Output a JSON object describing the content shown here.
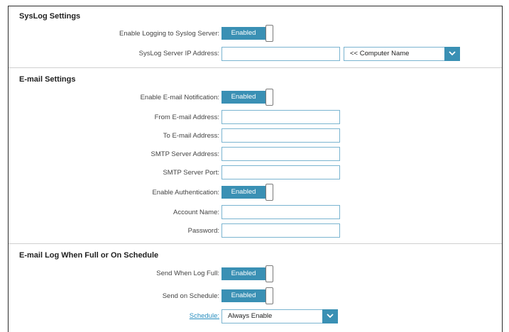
{
  "syslog": {
    "title": "SysLog Settings",
    "enable_label": "Enable Logging to Syslog Server:",
    "enable_state": "Enabled",
    "ip_label": "SysLog Server IP Address:",
    "ip_value": "",
    "computer_select": "<< Computer Name"
  },
  "email": {
    "title": "E-mail Settings",
    "notify_label": "Enable E-mail Notification:",
    "notify_state": "Enabled",
    "from_label": "From E-mail Address:",
    "from_value": "",
    "to_label": "To E-mail Address:",
    "to_value": "",
    "smtp_address_label": "SMTP Server Address:",
    "smtp_address_value": "",
    "smtp_port_label": "SMTP Server Port:",
    "smtp_port_value": "",
    "auth_label": "Enable Authentication:",
    "auth_state": "Enabled",
    "account_label": "Account Name:",
    "account_value": "",
    "password_label": "Password:",
    "password_value": ""
  },
  "schedule": {
    "title": "E-mail Log When Full or On Schedule",
    "full_label": "Send When Log Full:",
    "full_state": "Enabled",
    "on_schedule_label": "Send on Schedule:",
    "on_schedule_state": "Enabled",
    "schedule_link": "Schedule:",
    "schedule_select": "Always Enable"
  },
  "colors": {
    "accent": "#3a90b4",
    "input_border": "#7ab4d0",
    "link": "#2a8fc0"
  },
  "icons": {
    "dropdown": "chevron-down-icon"
  }
}
